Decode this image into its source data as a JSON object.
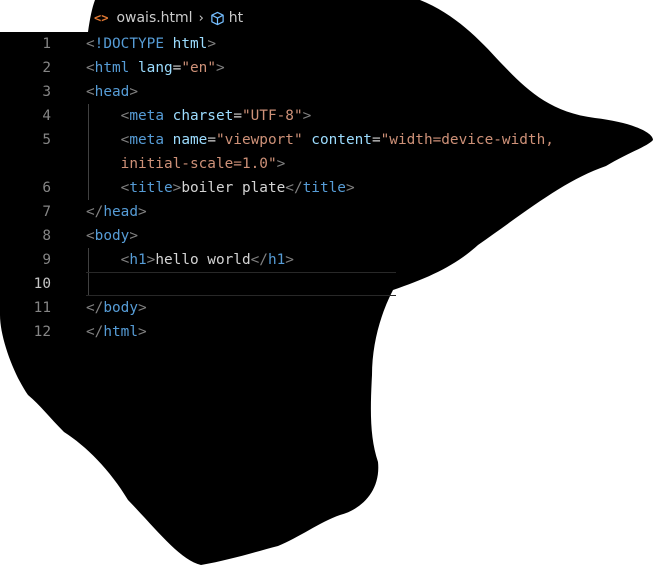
{
  "breadcrumb": {
    "file_name": "owais.html",
    "next_crumb": "ht",
    "file_icon": "html-file-icon",
    "separator_icon": "chevron-right-icon",
    "element_icon": "cube-icon"
  },
  "editor": {
    "current_line": 10,
    "lines": [
      {
        "num": "1",
        "parts": [
          [
            "p",
            "<"
          ],
          [
            "t",
            "!DOCTYPE"
          ],
          [
            "tx",
            " "
          ],
          [
            "a",
            "html"
          ],
          [
            "p",
            ">"
          ]
        ]
      },
      {
        "num": "2",
        "parts": [
          [
            "p",
            "<"
          ],
          [
            "t",
            "html"
          ],
          [
            "tx",
            " "
          ],
          [
            "a",
            "lang"
          ],
          [
            "tx",
            "="
          ],
          [
            "s",
            "\"en\""
          ],
          [
            "p",
            ">"
          ]
        ]
      },
      {
        "num": "3",
        "parts": [
          [
            "p",
            "<"
          ],
          [
            "t",
            "head"
          ],
          [
            "p",
            ">"
          ]
        ]
      },
      {
        "num": "4",
        "parts": [
          [
            "tx",
            "    "
          ],
          [
            "p",
            "<"
          ],
          [
            "t",
            "meta"
          ],
          [
            "tx",
            " "
          ],
          [
            "a",
            "charset"
          ],
          [
            "tx",
            "="
          ],
          [
            "s",
            "\"UTF-8\""
          ],
          [
            "p",
            ">"
          ]
        ]
      },
      {
        "num": "5",
        "parts": [
          [
            "tx",
            "    "
          ],
          [
            "p",
            "<"
          ],
          [
            "t",
            "meta"
          ],
          [
            "tx",
            " "
          ],
          [
            "a",
            "name"
          ],
          [
            "tx",
            "="
          ],
          [
            "s",
            "\"viewport\""
          ],
          [
            "tx",
            " "
          ],
          [
            "a",
            "content"
          ],
          [
            "tx",
            "="
          ],
          [
            "s",
            "\"width=device-width,"
          ]
        ]
      },
      {
        "num": "",
        "parts": [
          [
            "tx",
            "    "
          ],
          [
            "s",
            "initial-scale=1.0\""
          ],
          [
            "p",
            ">"
          ]
        ]
      },
      {
        "num": "6",
        "parts": [
          [
            "tx",
            "    "
          ],
          [
            "p",
            "<"
          ],
          [
            "t",
            "title"
          ],
          [
            "p",
            ">"
          ],
          [
            "tx",
            "boiler plate"
          ],
          [
            "p",
            "</"
          ],
          [
            "t",
            "title"
          ],
          [
            "p",
            ">"
          ]
        ]
      },
      {
        "num": "7",
        "parts": [
          [
            "p",
            "</"
          ],
          [
            "t",
            "head"
          ],
          [
            "p",
            ">"
          ]
        ]
      },
      {
        "num": "8",
        "parts": [
          [
            "p",
            "<"
          ],
          [
            "t",
            "body"
          ],
          [
            "p",
            ">"
          ]
        ]
      },
      {
        "num": "9",
        "parts": [
          [
            "tx",
            "    "
          ],
          [
            "p",
            "<"
          ],
          [
            "t",
            "h1"
          ],
          [
            "p",
            ">"
          ],
          [
            "tx",
            "hello world"
          ],
          [
            "p",
            "</"
          ],
          [
            "t",
            "h1"
          ],
          [
            "p",
            ">"
          ]
        ]
      },
      {
        "num": "10",
        "parts": [
          [
            "tx",
            "    "
          ]
        ]
      },
      {
        "num": "11",
        "parts": [
          [
            "p",
            "</"
          ],
          [
            "t",
            "body"
          ],
          [
            "p",
            ">"
          ]
        ]
      },
      {
        "num": "12",
        "parts": [
          [
            "p",
            "</"
          ],
          [
            "t",
            "html"
          ],
          [
            "p",
            ">"
          ]
        ]
      }
    ]
  },
  "colors": {
    "background_mask": "#000000",
    "page_background": "#ffffff",
    "tag": "#569cd6",
    "bracket": "#808080",
    "attribute": "#9cdcfe",
    "string": "#ce9178",
    "text": "#d4d4d4",
    "line_number": "#858585",
    "html_icon": "#e37933",
    "cube_icon": "#75beff"
  }
}
